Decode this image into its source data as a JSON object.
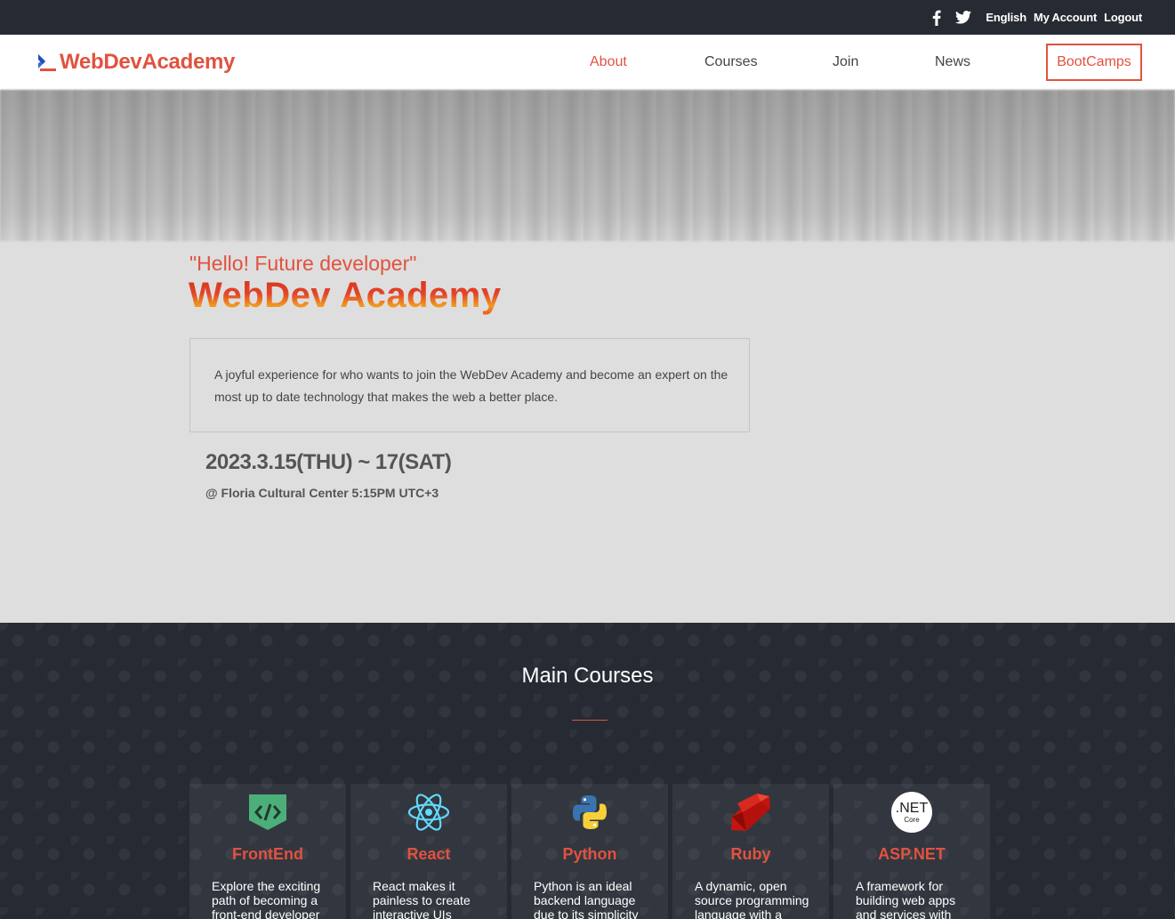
{
  "topbar": {
    "social": [
      "facebook-icon",
      "twitter-icon"
    ],
    "language": "English",
    "account": "My Account",
    "logout": "Logout"
  },
  "nav": {
    "logo": "WebDevAcademy",
    "items": [
      "About",
      "Courses",
      "Join",
      "News"
    ],
    "active": "About",
    "cta": "BootCamps"
  },
  "hero": {
    "quote": "\"Hello! Future developer\"",
    "title": "WebDev Academy",
    "description": "A joyful experience for who wants to join the WebDev Academy and become an expert on the most up to date technology that makes the web a better place.",
    "date": "2023.3.15(THU) ~ 17(SAT)",
    "venue": "@ Floria Cultural Center 5:15PM UTC+3"
  },
  "courses": {
    "title": "Main Courses",
    "items": [
      {
        "name": "FrontEnd",
        "icon": "html-code-icon",
        "description": "Explore the exciting path of becoming a front-end developer"
      },
      {
        "name": "React",
        "icon": "react-icon",
        "description": "React makes it painless to create interactive UIs"
      },
      {
        "name": "Python",
        "icon": "python-icon",
        "description": "Python is an ideal backend language due to its simplicity"
      },
      {
        "name": "Ruby",
        "icon": "ruby-icon",
        "description": "A dynamic, open source programming language with a focus"
      },
      {
        "name": "ASP.NET",
        "icon": "dotnet-core-icon",
        "icon_text": [
          ".NET",
          "Core"
        ],
        "description": "A framework for building web apps and services with"
      }
    ]
  },
  "colors": {
    "accent": "#e1523f",
    "dark": "#262a33",
    "hero_bg": "#dedede"
  }
}
